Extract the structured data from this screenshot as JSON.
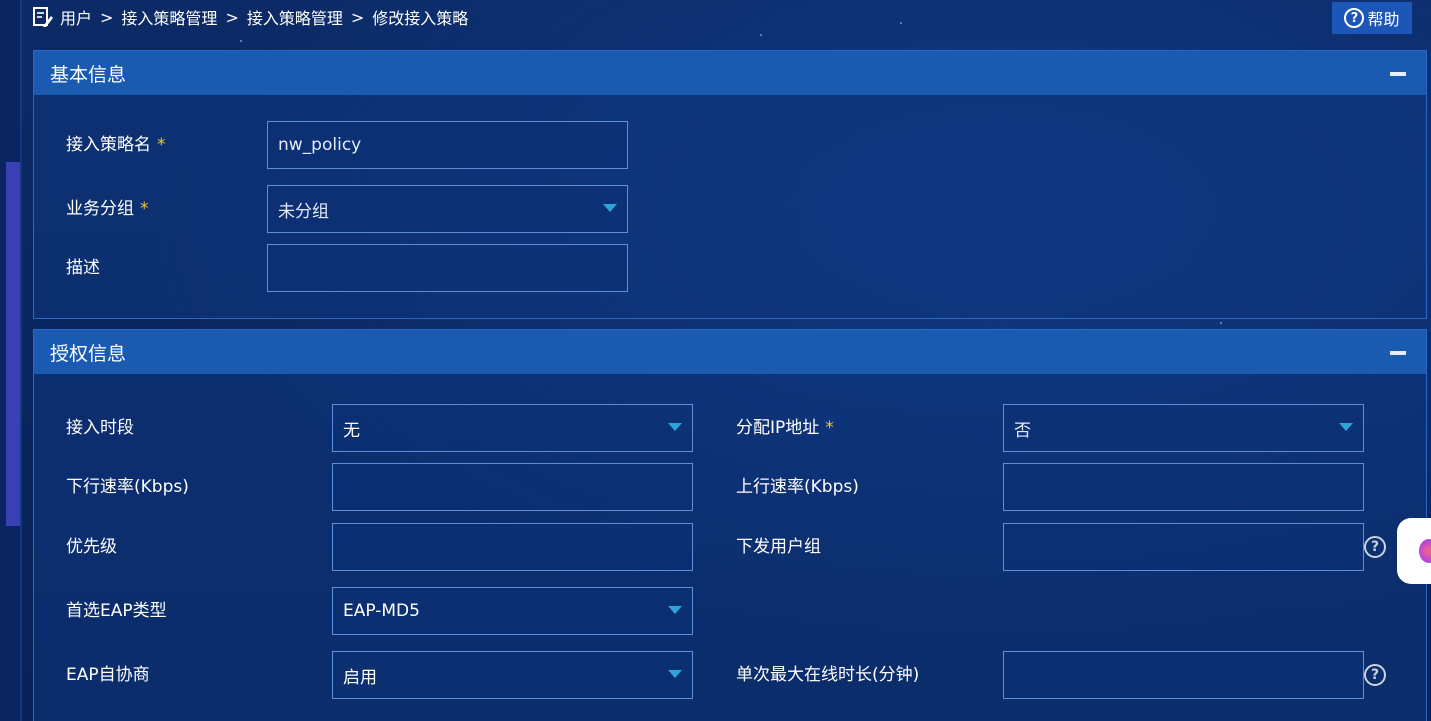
{
  "breadcrumb": {
    "icon": "edit-document-icon",
    "items": [
      "用户",
      "接入策略管理",
      "接入策略管理",
      "修改接入策略"
    ],
    "separator": ">"
  },
  "help": {
    "label": "帮助",
    "icon": "question-circle-icon"
  },
  "basic_info": {
    "title": "基本信息",
    "policy_name": {
      "label": "接入策略名",
      "required": "*",
      "value": "nw_policy"
    },
    "service_group": {
      "label": "业务分组",
      "required": "*",
      "value": "未分组"
    },
    "description": {
      "label": "描述",
      "value": ""
    }
  },
  "auth_info": {
    "title": "授权信息",
    "access_period": {
      "label": "接入时段",
      "value": "无"
    },
    "assign_ip": {
      "label": "分配IP地址",
      "required": "*",
      "value": "否"
    },
    "downlink_rate": {
      "label": "下行速率(Kbps)",
      "value": ""
    },
    "uplink_rate": {
      "label": "上行速率(Kbps)",
      "value": ""
    },
    "priority": {
      "label": "优先级",
      "value": ""
    },
    "deliver_user_group": {
      "label": "下发用户组",
      "value": ""
    },
    "preferred_eap": {
      "label": "首选EAP类型",
      "value": "EAP-MD5"
    },
    "eap_negotiation": {
      "label": "EAP自协商",
      "value": "启用"
    },
    "max_online_duration": {
      "label": "单次最大在线时长(分钟)",
      "value": ""
    }
  },
  "colors": {
    "background": "#0b2a66",
    "panel_header": "#1a5bb1",
    "required_mark": "#f2c62f",
    "select_caret": "#2ea5d8"
  }
}
